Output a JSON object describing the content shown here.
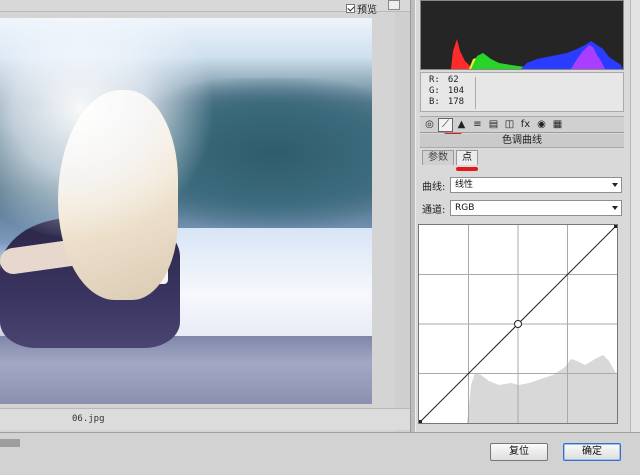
{
  "preview": {
    "checkbox_label": "预览",
    "checkbox_checked": true,
    "filename": "06.jpg"
  },
  "readout": {
    "r_label": "R:",
    "r_value": "62",
    "g_label": "G:",
    "g_value": "104",
    "b_label": "B:",
    "b_value": "178"
  },
  "toolbar": {
    "tools": [
      {
        "name": "basic-icon",
        "glyph": "◎"
      },
      {
        "name": "tone-curve-icon",
        "glyph": "⟋",
        "active": true
      },
      {
        "name": "detail-icon",
        "glyph": "▲"
      },
      {
        "name": "hsl-icon",
        "glyph": "≡"
      },
      {
        "name": "split-toning-icon",
        "glyph": "▤"
      },
      {
        "name": "lens-icon",
        "glyph": "◫"
      },
      {
        "name": "effects-icon",
        "glyph": "fx"
      },
      {
        "name": "camera-calibration-icon",
        "glyph": "◉"
      },
      {
        "name": "presets-icon",
        "glyph": "▦"
      }
    ]
  },
  "panel": {
    "title": "色调曲线",
    "tabs": [
      "参数",
      "点"
    ],
    "selected_tab": "点",
    "curve_label": "曲线:",
    "curve_value": "线性",
    "channel_label": "通道:",
    "channel_value": "RGB"
  },
  "buttons": {
    "reset": "复位",
    "ok": "确定"
  },
  "colors": {
    "annotation_red": "#e21a1a",
    "histogram_red": "#ff2a2a",
    "histogram_green": "#28d428",
    "histogram_yellow": "#f0f020",
    "histogram_blue": "#2a3cff"
  }
}
